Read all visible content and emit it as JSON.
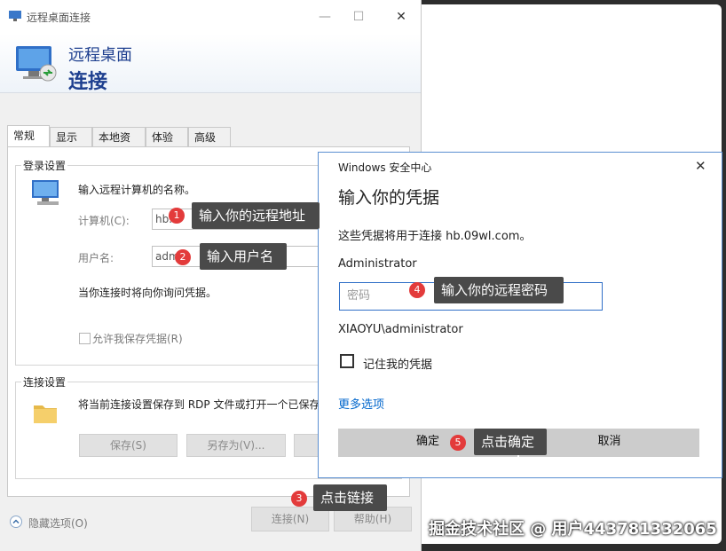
{
  "rdp_window": {
    "title": "远程桌面连接",
    "header_line1": "远程桌面",
    "header_line2": "连接",
    "tabs": [
      "常规",
      "显示",
      "本地资源",
      "体验",
      "高级"
    ],
    "login_group": "登录设置",
    "login_prompt": "输入远程计算机的名称。",
    "computer_label": "计算机(C):",
    "computer_value": "hb.",
    "username_label": "用户名:",
    "username_value": "adm",
    "ask_note": "当你连接时将向你询问凭据。",
    "save_cred_label": "允许我保存凭据(R)",
    "conn_group": "连接设置",
    "conn_text": "将当前连接设置保存到 RDP 文件或打开一个已保存",
    "save_btn": "保存(S)",
    "save_as_btn": "另存为(V)...",
    "hide_options": "隐藏选项(O)",
    "connect_btn": "连接(N)",
    "help_btn": "帮助(H)"
  },
  "security_dialog": {
    "title": "Windows 安全中心",
    "heading": "输入你的凭据",
    "info": "这些凭据将用于连接 hb.09wl.com。",
    "account": "Administrator",
    "password_placeholder": "密码",
    "alt_account": "XIAOYU\\administrator",
    "remember_label": "记住我的凭据",
    "more_options": "更多选项",
    "ok_btn": "确定",
    "cancel_btn": "取消"
  },
  "annotations": [
    {
      "num": "1",
      "text": "输入你的远程地址"
    },
    {
      "num": "2",
      "text": "输入用户名"
    },
    {
      "num": "3",
      "text": "点击链接"
    },
    {
      "num": "4",
      "text": "输入你的远程密码"
    },
    {
      "num": "5",
      "text": "点击确定"
    }
  ],
  "watermark": "掘金技术社区 @ 用户443781332065",
  "colors": {
    "accent_blue": "#1e3f8f",
    "link_blue": "#0066cc",
    "badge_red": "#e33b3b",
    "callout_bg": "#4a4a4a"
  }
}
